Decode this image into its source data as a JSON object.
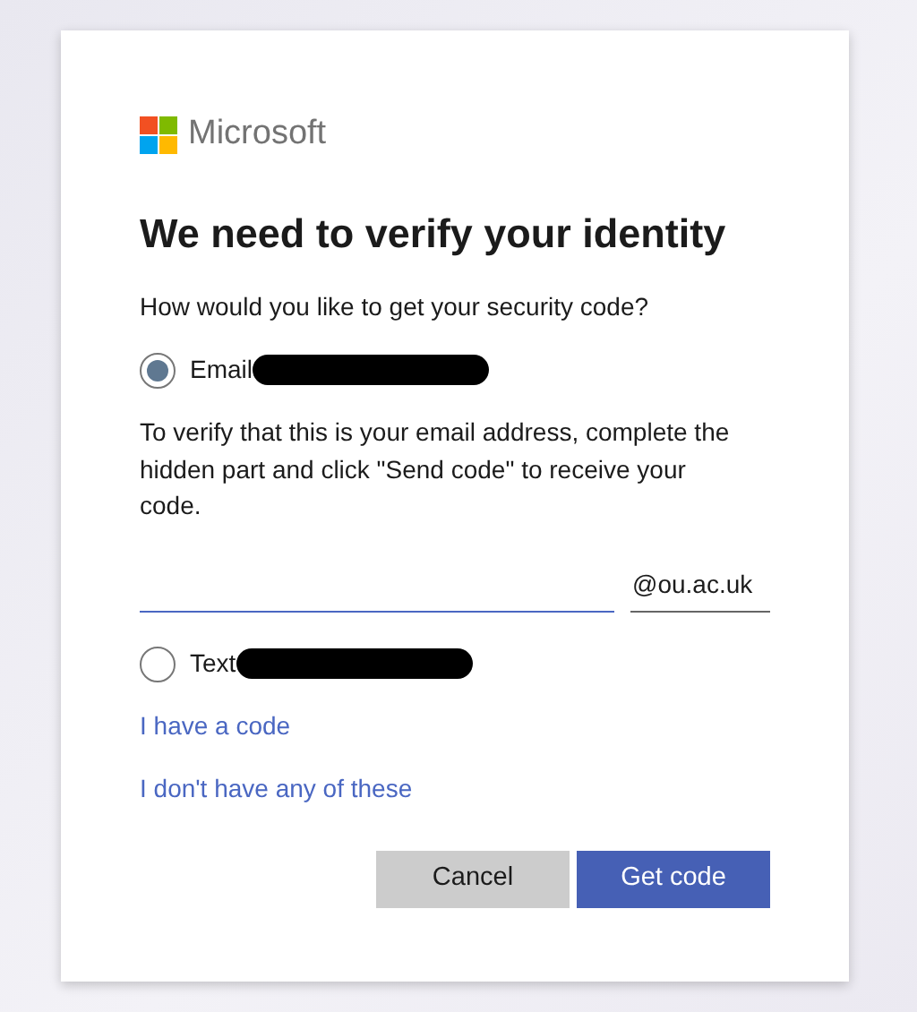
{
  "logo": {
    "text": "Microsoft"
  },
  "title": "We need to verify your identity",
  "prompt": "How would you like to get your security code?",
  "options": [
    {
      "label": "Email",
      "selected": true,
      "redacted": true,
      "hint": "To verify that this is your email address, complete the hidden part and click \"Send code\" to receive your code.",
      "suffix": "@ou.ac.uk"
    },
    {
      "label": "Text",
      "selected": false,
      "redacted": true
    }
  ],
  "links": [
    "I have a code",
    "I don't have any of these"
  ],
  "buttons": [
    {
      "label": "Cancel",
      "kind": "secondary"
    },
    {
      "label": "Get code",
      "kind": "primary"
    }
  ]
}
